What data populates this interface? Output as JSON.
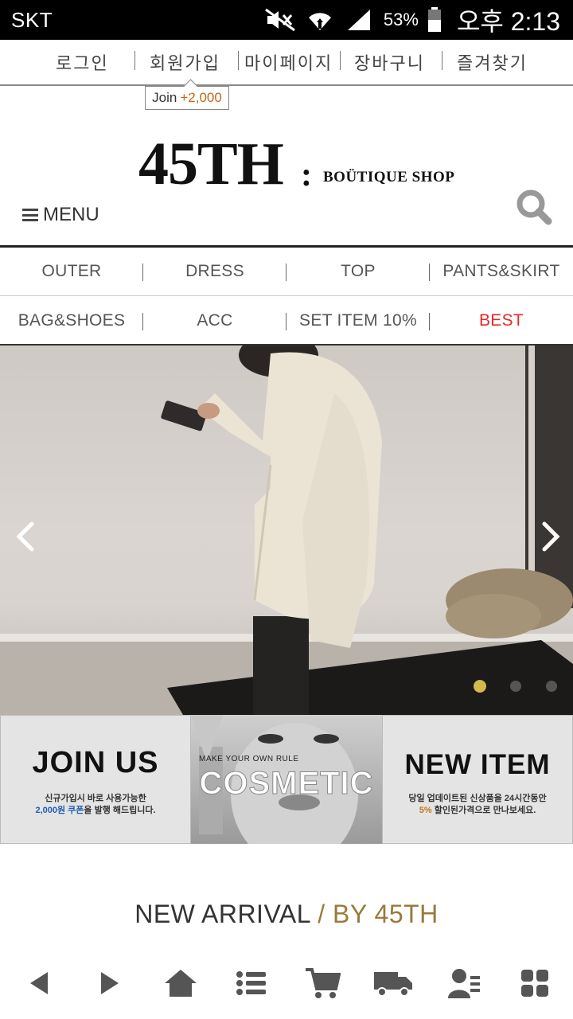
{
  "status_bar": {
    "carrier": "SKT",
    "battery_percent": "53%",
    "time": "오후 2:13",
    "icons": [
      "mute-icon",
      "wifi-icon",
      "signal-icon",
      "battery-icon"
    ]
  },
  "top_links": {
    "login": "로그인",
    "signup": "회원가입",
    "mypage": "마이페이지",
    "cart": "장바구니",
    "favorites": "즐겨찾기"
  },
  "join_badge": {
    "label": "Join",
    "bonus": "+2,000"
  },
  "header": {
    "logo": "45TH",
    "logo_colon": ":",
    "logo_sub": "BOÜTIQUE SHOP",
    "menu_label": "MENU"
  },
  "categories": {
    "row1": [
      "OUTER",
      "DRESS",
      "TOP",
      "PANTS&SKIRT"
    ],
    "row2": [
      "BAG&SHOES",
      "ACC",
      "SET ITEM 10%",
      "BEST"
    ]
  },
  "hero": {
    "slide_count": 3,
    "active_slide": 1
  },
  "promos": {
    "join": {
      "title": "JOIN US",
      "line1": "신규가입시 바로 사용가능한",
      "line2_highlight": "2,000원 쿠폰",
      "line2_rest": "을 발행 해드립니다."
    },
    "cosmetic": {
      "small": "MAKE YOUR OWN RULE",
      "title": "COSMETIC"
    },
    "new_item": {
      "title": "NEW ITEM",
      "line1": "당일 업데이트된 신상품을 24시간동안",
      "line2_highlight": "5%",
      "line2_rest": " 할인된가격으로 만나보세요."
    }
  },
  "section": {
    "title": "NEW ARRIVAL",
    "separator": " / ",
    "by": "BY 45TH"
  },
  "bottom_bar": [
    "back-icon",
    "forward-icon",
    "home-icon",
    "list-icon",
    "cart-icon",
    "delivery-icon",
    "account-icon",
    "grid-icon"
  ],
  "colors": {
    "best": "#e8282b",
    "accent_gold": "#9a7a3b",
    "join_bonus": "#c0661b"
  }
}
